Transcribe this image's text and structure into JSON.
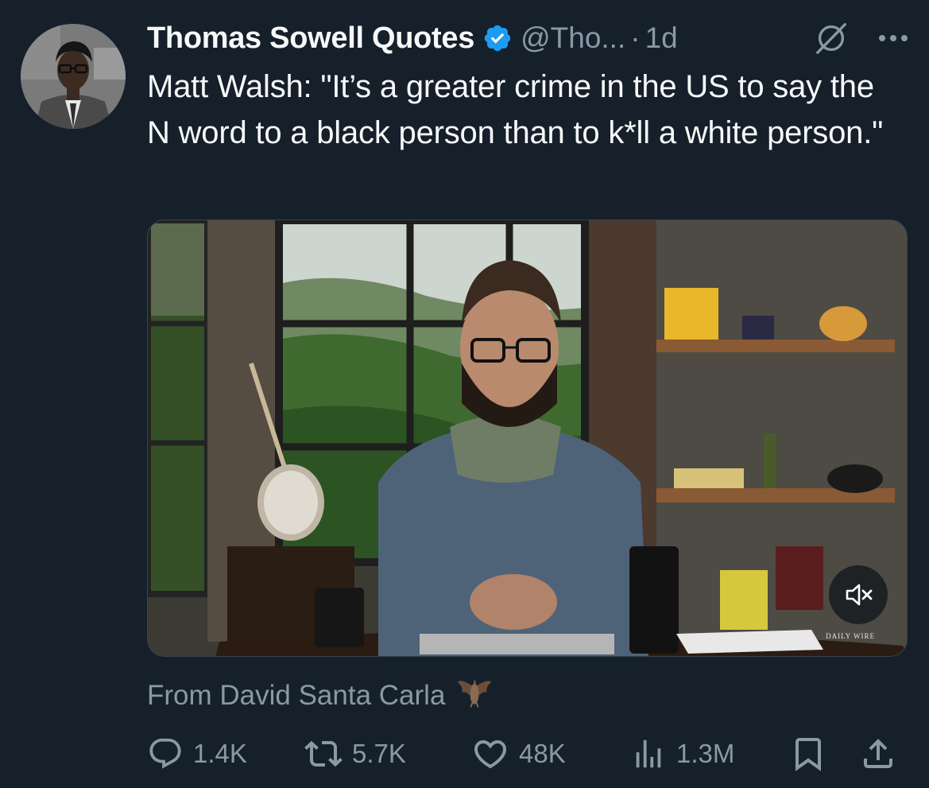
{
  "tweet": {
    "display_name": "Thomas Sowell Quotes",
    "verified_icon": "verified-badge-icon",
    "handle": "@Tho...",
    "separator": "·",
    "time": "1d",
    "text": "Matt Walsh: \"It’s a greater crime in the US to say the N word to a black person than to k*ll a white person.\"",
    "media": {
      "watermark": "DAILY WIRE",
      "mute_icon": "speaker-muted-icon"
    },
    "source": {
      "text": "From David Santa Carla",
      "icon": "bat-icon"
    },
    "actions": {
      "replies": "1.4K",
      "reposts": "5.7K",
      "likes": "48K",
      "views": "1.3M"
    }
  },
  "colors": {
    "background": "#15202b",
    "primary_text": "#f7f9f9",
    "secondary_text": "#8b98a5",
    "verified": "#1d9bf0"
  }
}
